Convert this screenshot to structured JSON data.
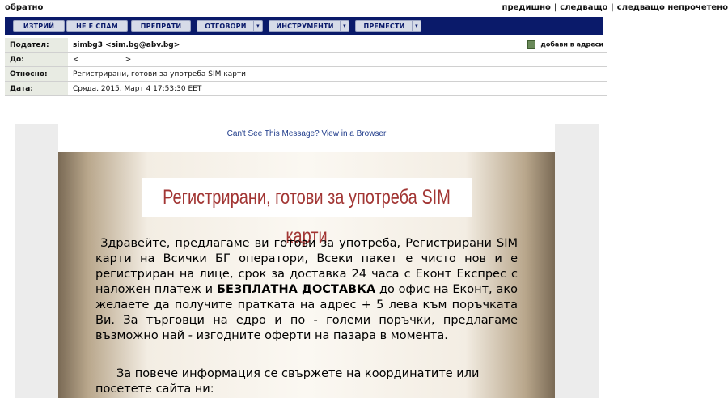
{
  "nav": {
    "back": "обратно",
    "prev": "предишно",
    "next": "следващо",
    "next_unread": "следващо непрочетено"
  },
  "toolbar": {
    "delete": "ИЗТРИЙ",
    "not_spam": "НЕ Е СПАМ",
    "forward": "ПРЕПРАТИ",
    "reply": "ОТГОВОРИ",
    "tools": "ИНСТРУМЕНТИ",
    "move": "ПРЕМЕСТИ",
    "dropdown_glyph": "▾"
  },
  "headers": {
    "from_label": "Подател:",
    "from_value": "simbg3 <sim.bg@abv.bg>",
    "add_address": "добави в адреси",
    "to_label": "До:",
    "to_value": "<                    >",
    "subject_label": "Относно:",
    "subject_value": "Регистрирани, готови за употреба SIM карти",
    "date_label": "Дата:",
    "date_value": "Сряда, 2015, Март 4 17:53:30 EET"
  },
  "message": {
    "cant_see": "Can't See This Message? View in a Browser",
    "title": "Регистрирани, готови за употреба SIM карти",
    "para1_a": " Здравейте, предлагаме ви готови за употреба, Регистрирани SIM карти на Всички БГ оператори, Всеки пакет е чисто нов и е регистриран на лице, срок за доставка 24 часа с Еконт Експрес с наложен платеж и ",
    "para1_bold": "БЕЗПЛАТНА ДОСТАВКА",
    "para1_b": " до офис на Еконт, ако желаете да получите пратката на адрес + 5 лева към поръчката Ви. За търговци на едро и по - големи поръчки, предлагаме възможно най - изгодните оферти на пазара в момента.",
    "para2": "За повече информация се свържете на координатите или посетете сайта ни:"
  }
}
